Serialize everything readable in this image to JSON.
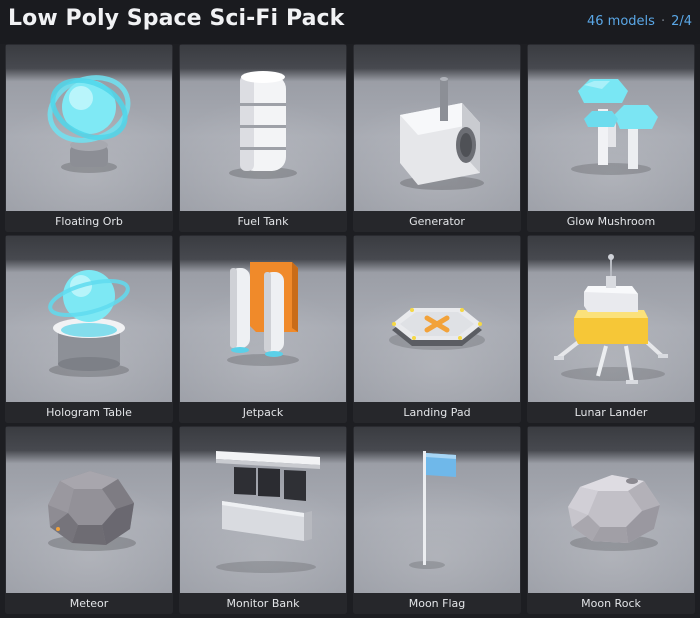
{
  "header": {
    "title": "Low Poly Space Sci-Fi Pack",
    "model_count": "46 models",
    "separator": "·",
    "page": "2/4"
  },
  "models": [
    {
      "name": "Floating Orb",
      "icon": "floating-orb-icon"
    },
    {
      "name": "Fuel Tank",
      "icon": "fuel-tank-icon"
    },
    {
      "name": "Generator",
      "icon": "generator-icon"
    },
    {
      "name": "Glow Mushroom",
      "icon": "glow-mushroom-icon"
    },
    {
      "name": "Hologram Table",
      "icon": "hologram-table-icon"
    },
    {
      "name": "Jetpack",
      "icon": "jetpack-icon"
    },
    {
      "name": "Landing Pad",
      "icon": "landing-pad-icon"
    },
    {
      "name": "Lunar Lander",
      "icon": "lunar-lander-icon"
    },
    {
      "name": "Meteor",
      "icon": "meteor-icon"
    },
    {
      "name": "Monitor Bank",
      "icon": "monitor-bank-icon"
    },
    {
      "name": "Moon Flag",
      "icon": "moon-flag-icon"
    },
    {
      "name": "Moon Rock",
      "icon": "moon-rock-icon"
    }
  ],
  "colors": {
    "accent": "#5aa7e6",
    "glow_cyan": "#6fe3f2",
    "lander_yellow": "#f5c842",
    "jetpack_orange": "#f08a2a",
    "flag_blue": "#6fb8ea"
  }
}
